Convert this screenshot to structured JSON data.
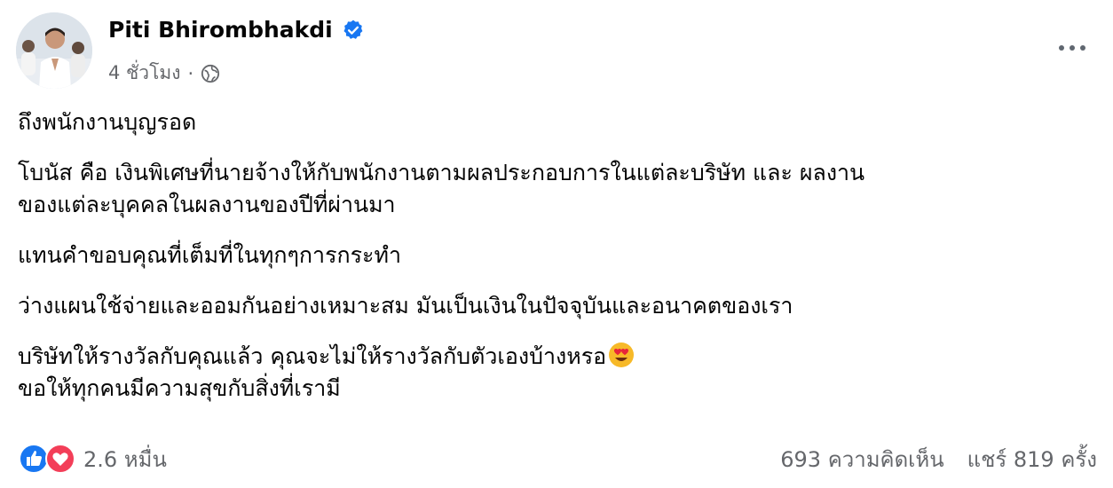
{
  "post": {
    "author": "Piti Bhirombhakdi",
    "time": "4 ชั่วโมง",
    "separator": "·"
  },
  "icons": {
    "verified": "verified-badge-icon",
    "privacy": "globe-icon",
    "more": "more-options-icon",
    "like": "like-icon",
    "love": "love-icon",
    "emoji": "heart-eyes-emoji-icon"
  },
  "colors": {
    "verified": "#1877f2",
    "like": "#1877f2",
    "love": "#f33e58",
    "muted": "#65676b"
  },
  "content": {
    "p1": "ถึงพนักงานบุญรอด",
    "p2_line1": "โบนัส คือ เงินพิเศษที่นายจ้างให้กับพนักงานตามผลประกอบการในแต่ละบริษัท และ ผลงาน",
    "p2_line2": "ของแต่ละบุคคลในผลงานของปีที่ผ่านมา",
    "p3": "แทนคำขอบคุณที่เต็มที่ในทุกๆการกระทำ",
    "p4": "ว่างแผนใช้จ่ายและออมกันอย่างเหมาะสม มันเป็นเงินในปัจจุบันและอนาคตของเรา",
    "p5_line1": "บริษัทให้รางวัลกับคุณแล้ว คุณจะไม่ให้รางวัลกับตัวเองบ้างหรอ",
    "p5_line2": "ขอให้ทุกคนมีความสุขกับสิ่งที่เรามี"
  },
  "footer": {
    "reactions": "2.6 หมื่น",
    "comments": "693 ความคิดเห็น",
    "shares": "แชร์ 819 ครั้ง"
  }
}
